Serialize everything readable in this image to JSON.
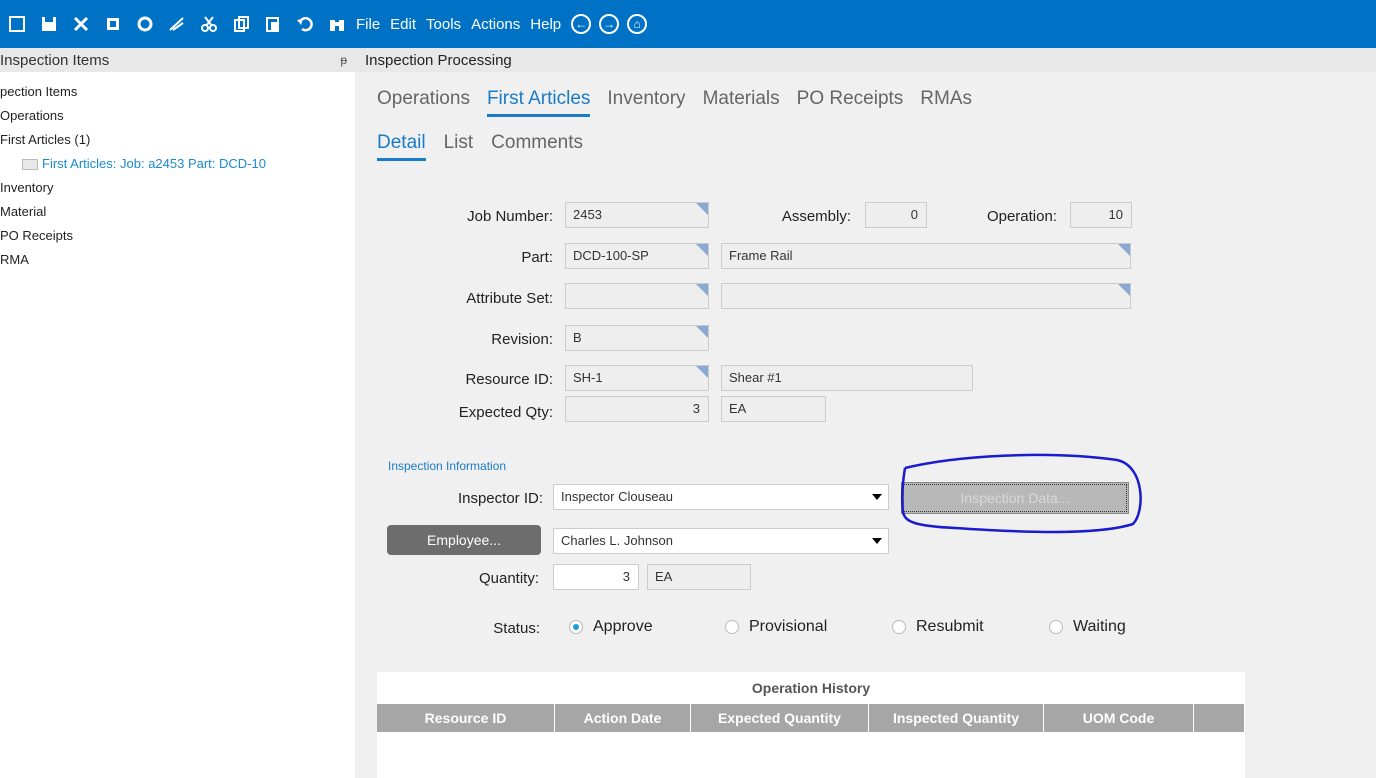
{
  "toolbar": {
    "menus": [
      "File",
      "Edit",
      "Tools",
      "Actions",
      "Help"
    ]
  },
  "left_panel": {
    "title": "Inspection Items",
    "tree": {
      "root": "pection Items",
      "items": [
        "Operations",
        "First Articles (1)",
        "Inventory",
        "Material",
        "PO Receipts",
        "RMA"
      ],
      "selected": "First Articles: Job: a2453 Part: DCD-10"
    }
  },
  "main": {
    "title": "Inspection Processing",
    "tabs": [
      "Operations",
      "First Articles",
      "Inventory",
      "Materials",
      "PO Receipts",
      "RMAs"
    ],
    "subtabs": [
      "Detail",
      "List",
      "Comments"
    ]
  },
  "form": {
    "job_number_label": "Job Number:",
    "job_number": "2453",
    "assembly_label": "Assembly:",
    "assembly": "0",
    "operation_label": "Operation:",
    "operation": "10",
    "part_label": "Part:",
    "part": "DCD-100-SP",
    "part_desc": "Frame Rail",
    "attribute_set_label": "Attribute Set:",
    "attribute_set": "",
    "attribute_set_desc": "",
    "revision_label": "Revision:",
    "revision": "B",
    "resource_id_label": "Resource ID:",
    "resource_id": "SH-1",
    "resource_desc": "Shear #1",
    "expected_qty_label": "Expected Qty:",
    "expected_qty": "3",
    "expected_uom": "EA"
  },
  "inspection": {
    "section_title": "Inspection Information",
    "inspector_id_label": "Inspector ID:",
    "inspector_id": "Inspector Clouseau",
    "inspection_data_button": "Inspection Data...",
    "employee_button": "Employee...",
    "employee": "Charles L. Johnson",
    "quantity_label": "Quantity:",
    "quantity": "3",
    "quantity_uom": "EA",
    "status_label": "Status:",
    "status_options": [
      "Approve",
      "Provisional",
      "Resubmit",
      "Waiting"
    ],
    "status_selected": "Approve"
  },
  "history": {
    "title": "Operation History",
    "columns": [
      "Resource ID",
      "Action Date",
      "Expected Quantity",
      "Inspected Quantity",
      "UOM Code",
      ""
    ]
  },
  "colors": {
    "toolbar": "#0072c6",
    "accent": "#1a7bc7",
    "annotation": "#1a1acf"
  }
}
